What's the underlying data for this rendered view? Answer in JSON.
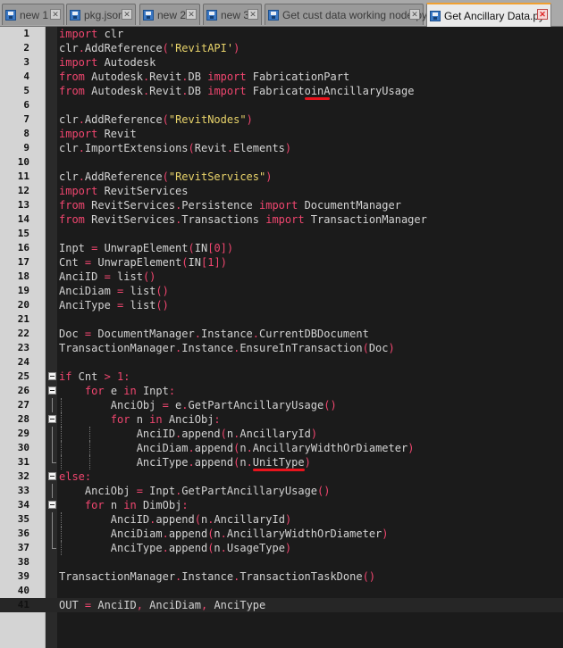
{
  "tabs": [
    {
      "label": "new 1",
      "active": false
    },
    {
      "label": "pkg.json",
      "active": false
    },
    {
      "label": "new 2",
      "active": false
    },
    {
      "label": "new 3",
      "active": false
    },
    {
      "label": "Get cust data working node.py",
      "active": false
    },
    {
      "label": "Get Ancillary Data.py",
      "active": true
    }
  ],
  "tab_close_glyph": "✕",
  "editor": {
    "theme": {
      "background": "#1b1b1b",
      "keyword": "#f0466f",
      "string": "#e8d36a",
      "text": "#d3d3d3",
      "gutter": "#d4d4d4",
      "active_tab_accent": "#f0a030",
      "annotation": "#e8141d"
    },
    "lines": [
      {
        "n": "1",
        "code": "import clr"
      },
      {
        "n": "2",
        "code": "clr.AddReference('RevitAPI')"
      },
      {
        "n": "3",
        "code": "import Autodesk"
      },
      {
        "n": "4",
        "code": "from Autodesk.Revit.DB import FabricationPart"
      },
      {
        "n": "5",
        "code": "from Autodesk.Revit.DB import FabricatoinAncillaryUsage"
      },
      {
        "n": "6",
        "code": ""
      },
      {
        "n": "7",
        "code": "clr.AddReference(\"RevitNodes\")"
      },
      {
        "n": "8",
        "code": "import Revit"
      },
      {
        "n": "9",
        "code": "clr.ImportExtensions(Revit.Elements)"
      },
      {
        "n": "10",
        "code": ""
      },
      {
        "n": "11",
        "code": "clr.AddReference(\"RevitServices\")"
      },
      {
        "n": "12",
        "code": "import RevitServices"
      },
      {
        "n": "13",
        "code": "from RevitServices.Persistence import DocumentManager"
      },
      {
        "n": "14",
        "code": "from RevitServices.Transactions import TransactionManager"
      },
      {
        "n": "15",
        "code": ""
      },
      {
        "n": "16",
        "code": "Inpt = UnwrapElement(IN[0])"
      },
      {
        "n": "17",
        "code": "Cnt = UnwrapElement(IN[1])"
      },
      {
        "n": "18",
        "code": "AnciID = list()"
      },
      {
        "n": "19",
        "code": "AnciDiam = list()"
      },
      {
        "n": "20",
        "code": "AnciType = list()"
      },
      {
        "n": "21",
        "code": ""
      },
      {
        "n": "22",
        "code": "Doc = DocumentManager.Instance.CurrentDBDocument"
      },
      {
        "n": "23",
        "code": "TransactionManager.Instance.EnsureInTransaction(Doc)"
      },
      {
        "n": "24",
        "code": ""
      },
      {
        "n": "25",
        "code": "if Cnt > 1:"
      },
      {
        "n": "26",
        "code": "    for e in Inpt:"
      },
      {
        "n": "27",
        "code": "        AnciObj = e.GetPartAncillaryUsage()"
      },
      {
        "n": "28",
        "code": "        for n in AnciObj:"
      },
      {
        "n": "29",
        "code": "            AnciID.append(n.AncillaryId)"
      },
      {
        "n": "30",
        "code": "            AnciDiam.append(n.AncillaryWidthOrDiameter)"
      },
      {
        "n": "31",
        "code": "            AnciType.append(n.UnitType)"
      },
      {
        "n": "32",
        "code": "else:"
      },
      {
        "n": "33",
        "code": "    AnciObj = Inpt.GetPartAncillaryUsage()"
      },
      {
        "n": "34",
        "code": "    for n in DimObj:"
      },
      {
        "n": "35",
        "code": "        AnciID.append(n.AncillaryId)"
      },
      {
        "n": "36",
        "code": "        AnciDiam.append(n.AncillaryWidthOrDiameter)"
      },
      {
        "n": "37",
        "code": "        AnciType.append(n.UsageType)"
      },
      {
        "n": "38",
        "code": ""
      },
      {
        "n": "39",
        "code": "TransactionManager.Instance.TransactionTaskDone()"
      },
      {
        "n": "40",
        "code": ""
      },
      {
        "n": "41",
        "code": "OUT = AnciID, AnciDiam, AnciType"
      }
    ],
    "current_line": "41"
  }
}
